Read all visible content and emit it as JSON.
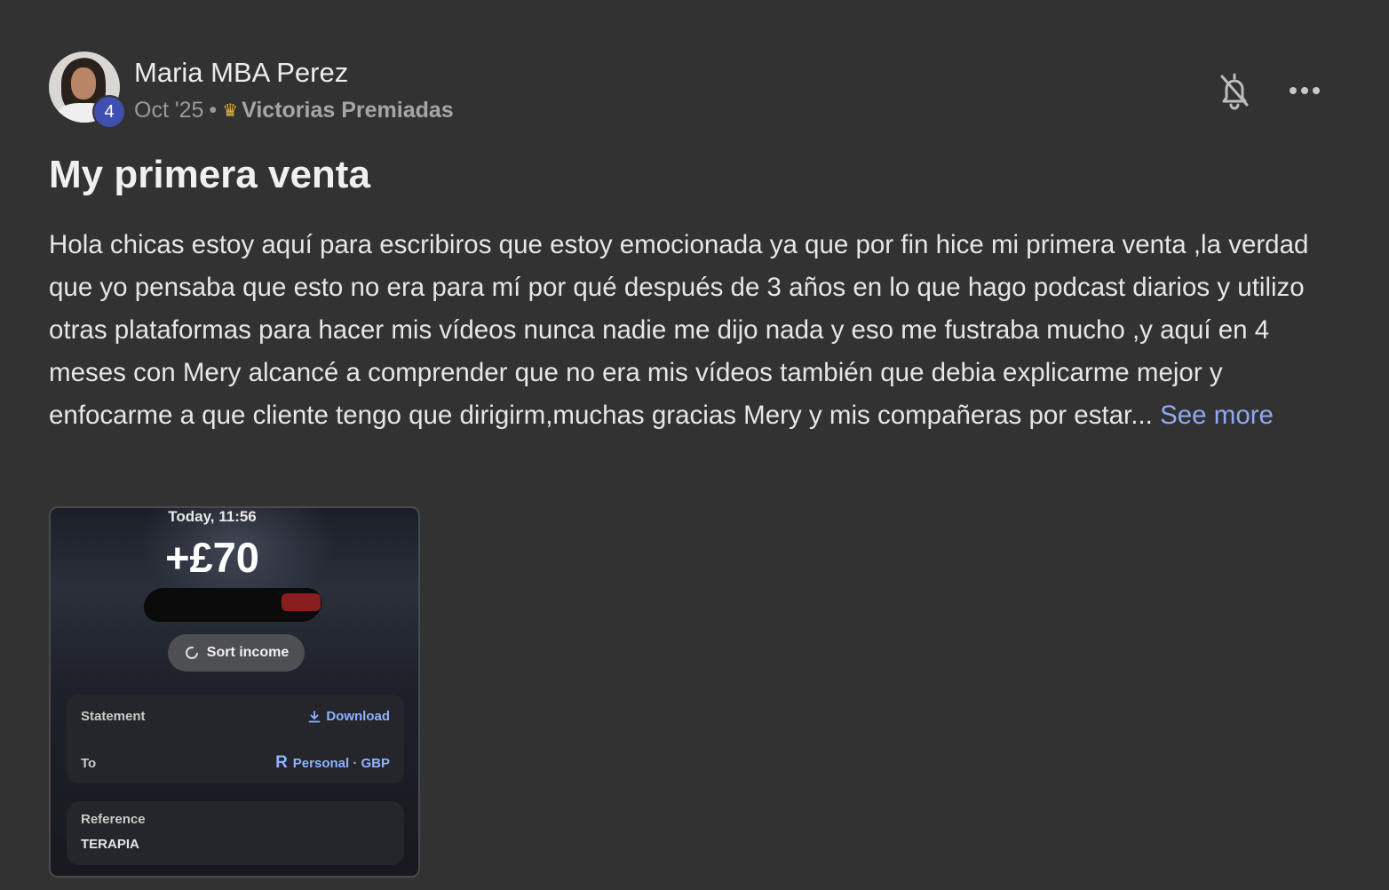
{
  "post": {
    "author": "Maria MBA Perez",
    "level": "4",
    "date": "Oct '25",
    "separator": "•",
    "category": "Victorias Premiadas",
    "category_icon": "crown-icon",
    "title": "My primera venta",
    "body": "Hola chicas estoy aquí para escribiros que estoy emocionada ya que por fin hice mi primera venta ,la verdad que yo pensaba que esto no era para mí por qué después de 3 años en lo que hago podcast diarios y utilizo otras plataformas para hacer mis vídeos nunca nadie me dijo nada y eso me fustraba mucho ,y aquí en 4 meses con Mery alcancé a comprender que no era mis vídeos también que debia explicarme mejor y enfocarme a que cliente tengo que dirigirm,muchas gracias Mery y mis compañeras por estar...",
    "see_more": "See more"
  },
  "header_actions": {
    "mute_icon": "bell-off-icon",
    "more_icon": "more-horizontal-icon"
  },
  "attachment": {
    "time": "Today, 11:56",
    "amount": "+£70",
    "sort_button": "Sort income",
    "statement_label": "Statement",
    "download_label": "Download",
    "to_label": "To",
    "to_value": "Personal · GBP",
    "reference_label": "Reference",
    "reference_value": "TERAPIA"
  },
  "colors": {
    "background": "#323232",
    "link": "#8fa8f2",
    "badge": "#3f4fb0"
  }
}
